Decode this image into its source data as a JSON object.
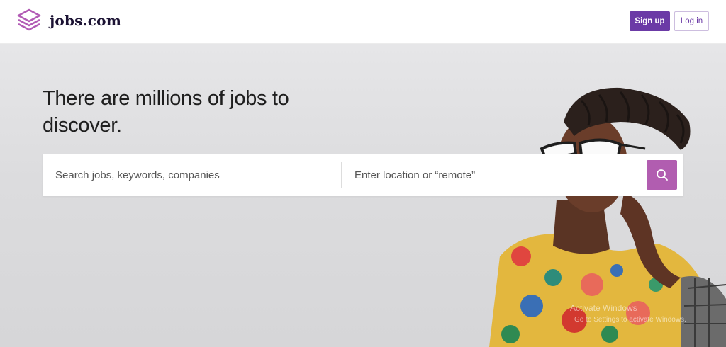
{
  "header": {
    "brand": "jobs.com",
    "signup_label": "Sign up",
    "login_label": "Log in",
    "accent_color": "#6b3aa6"
  },
  "hero": {
    "headline": "There are millions of jobs to discover.",
    "search": {
      "keywords_placeholder": "Search jobs, keywords, companies",
      "location_placeholder": "Enter location or “remote”",
      "button_icon": "search-icon",
      "button_color": "#b15db0"
    },
    "image": "woman-with-glasses-photo"
  },
  "overlay": {
    "line1": "Activate Windows",
    "line2": "Go to Settings to activate Windows."
  }
}
